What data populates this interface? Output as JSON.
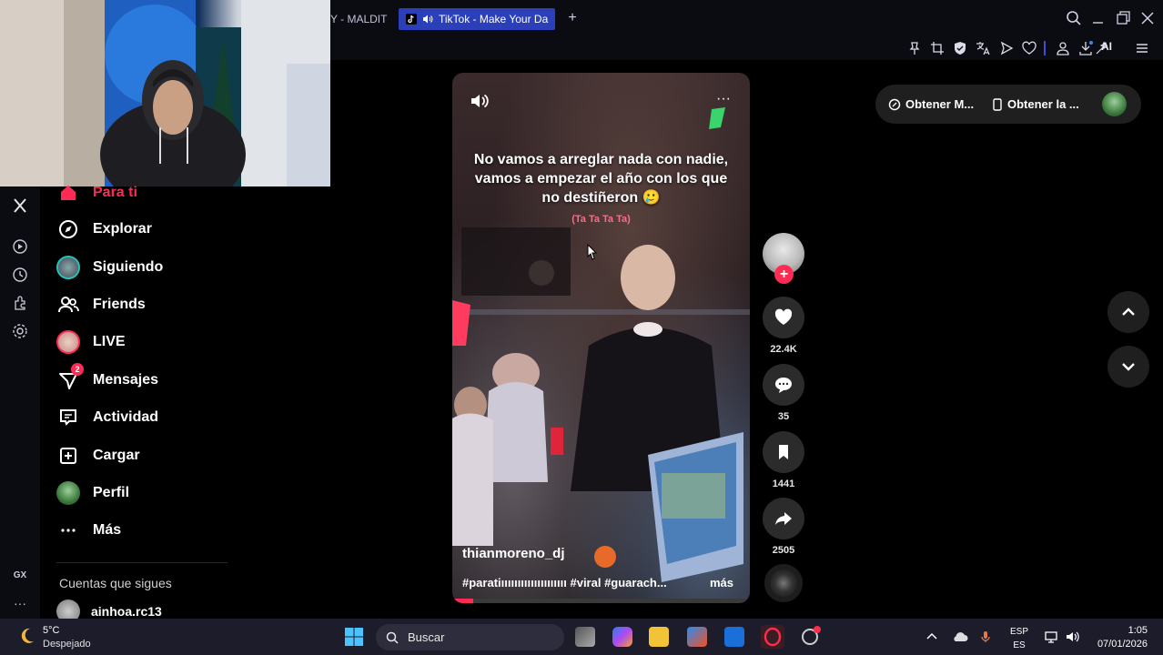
{
  "browser": {
    "tabs": [
      {
        "label": "Y - MALDIT",
        "active": false
      },
      {
        "label": "TikTok - Make Your Da",
        "active": true
      }
    ],
    "new_tab_label": "+",
    "ai_label": "AI",
    "accent_color": "#3b52d6"
  },
  "sidebar_strip": {
    "icons": [
      "x-icon",
      "play-circle-icon",
      "clock-icon",
      "extensions-icon",
      "settings-icon"
    ],
    "gx_label": "GX",
    "more_label": "···"
  },
  "nav": {
    "items": [
      {
        "label": "Para ti",
        "icon": "home-icon",
        "active": true
      },
      {
        "label": "Explorar",
        "icon": "compass-icon"
      },
      {
        "label": "Siguiendo",
        "icon": "following-avatar"
      },
      {
        "label": "Friends",
        "icon": "friends-icon"
      },
      {
        "label": "LIVE",
        "icon": "live-avatar"
      },
      {
        "label": "Mensajes",
        "icon": "messages-icon",
        "badge": "2"
      },
      {
        "label": "Actividad",
        "icon": "activity-icon"
      },
      {
        "label": "Cargar",
        "icon": "upload-icon"
      },
      {
        "label": "Perfil",
        "icon": "profile-avatar"
      },
      {
        "label": "Más",
        "icon": "more-icon"
      }
    ],
    "following_title": "Cuentas que sigues",
    "following_user": "ainhoa.rc13"
  },
  "video": {
    "caption": "No vamos a arreglar nada con nadie, vamos a empezar el año con los que no destiñeron 🥲",
    "sub_caption": "(Ta Ta Ta Ta)",
    "author": "thianmoreno_dj",
    "tags": "#paratiıııııııııııııııııııı #viral #guarach...",
    "more_label": "más",
    "progress": 0.07,
    "accent_color": "#fe2c55"
  },
  "actions": {
    "likes": "22.4K",
    "comments": "35",
    "saves": "1441",
    "shares": "2505"
  },
  "right_pill": {
    "item1": "Obtener M...",
    "item2": "Obtener la ..."
  },
  "taskbar": {
    "temperature": "5°C",
    "weather": "Despejado",
    "search_label": "Buscar",
    "lang_top": "ESP",
    "lang_bottom": "ES",
    "time": "1:05",
    "date": "07/01/2026"
  }
}
